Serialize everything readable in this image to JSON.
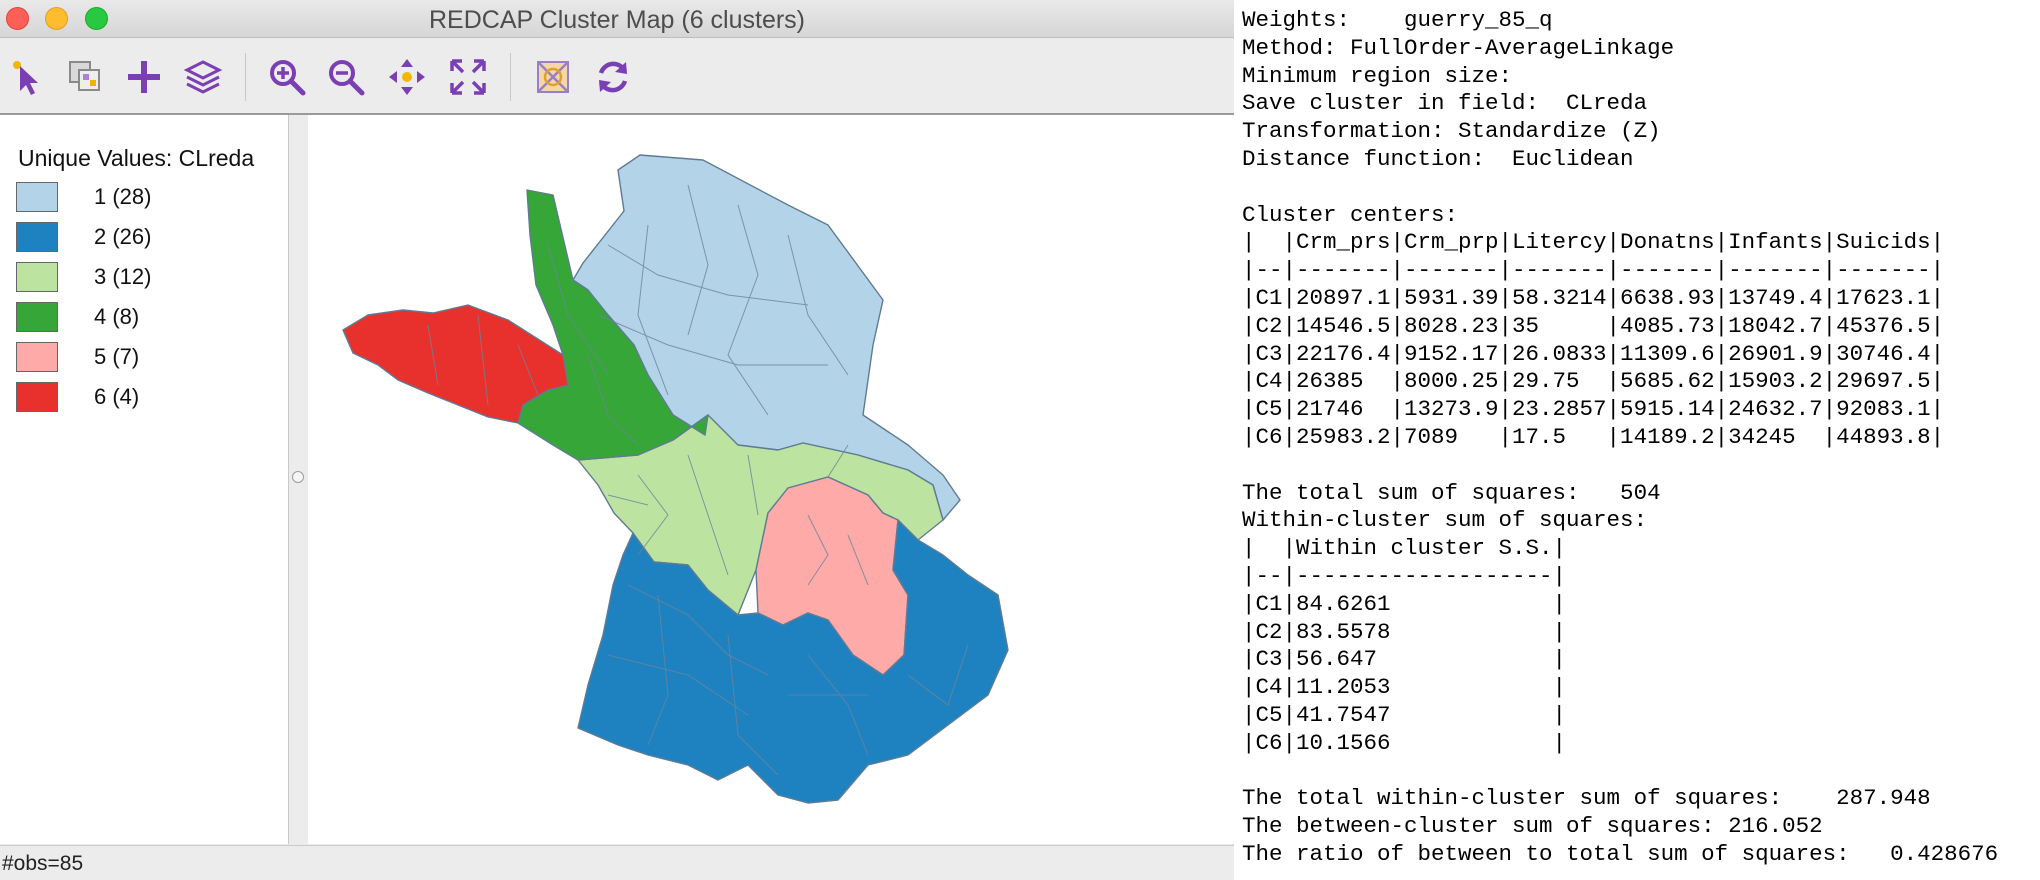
{
  "window": {
    "title": "REDCAP Cluster Map (6 clusters)"
  },
  "toolbar": {
    "icons": [
      "select-pointer-icon",
      "copy-image-icon",
      "add-plus-icon",
      "layers-icon",
      "zoom-in-icon",
      "zoom-out-icon",
      "pan-icon",
      "fit-extent-icon",
      "selection-shape-icon",
      "refresh-icon"
    ]
  },
  "legend": {
    "title": "Unique Values: CLreda",
    "items": [
      {
        "label": "1 (28)",
        "color": "#b3d3e8"
      },
      {
        "label": "2 (26)",
        "color": "#1f82c0"
      },
      {
        "label": "3 (12)",
        "color": "#bde3a0"
      },
      {
        "label": "4 (8)",
        "color": "#37a638"
      },
      {
        "label": "5 (7)",
        "color": "#fdaaa8"
      },
      {
        "label": "6 (4)",
        "color": "#e8312d"
      }
    ]
  },
  "status": {
    "obs": "#obs=85"
  },
  "report": {
    "lines": [
      "Weights:    guerry_85_q",
      "Method: FullOrder-AverageLinkage",
      "Minimum region size:",
      "Save cluster in field:  CLreda",
      "Transformation: Standardize (Z)",
      "Distance function:  Euclidean",
      "",
      "Cluster centers:",
      "|  |Crm_prs|Crm_prp|Litercy|Donatns|Infants|Suicids|",
      "|--|-------|-------|-------|-------|-------|-------|",
      "|C1|20897.1|5931.39|58.3214|6638.93|13749.4|17623.1|",
      "|C2|14546.5|8028.23|35     |4085.73|18042.7|45376.5|",
      "|C3|22176.4|9152.17|26.0833|11309.6|26901.9|30746.4|",
      "|C4|26385  |8000.25|29.75  |5685.62|15903.2|29697.5|",
      "|C5|21746  |13273.9|23.2857|5915.14|24632.7|92083.1|",
      "|C6|25983.2|7089   |17.5   |14189.2|34245  |44893.8|",
      "",
      "The total sum of squares:   504",
      "Within-cluster sum of squares:",
      "|  |Within cluster S.S.|",
      "|--|-------------------|",
      "|C1|84.6261            |",
      "|C2|83.5578            |",
      "|C3|56.647             |",
      "|C4|11.2053            |",
      "|C5|41.7547            |",
      "|C6|10.1566            |",
      "",
      "The total within-cluster sum of squares:    287.948",
      "The between-cluster sum of squares: 216.052",
      "The ratio of between to total sum of squares:   0.428676"
    ]
  }
}
